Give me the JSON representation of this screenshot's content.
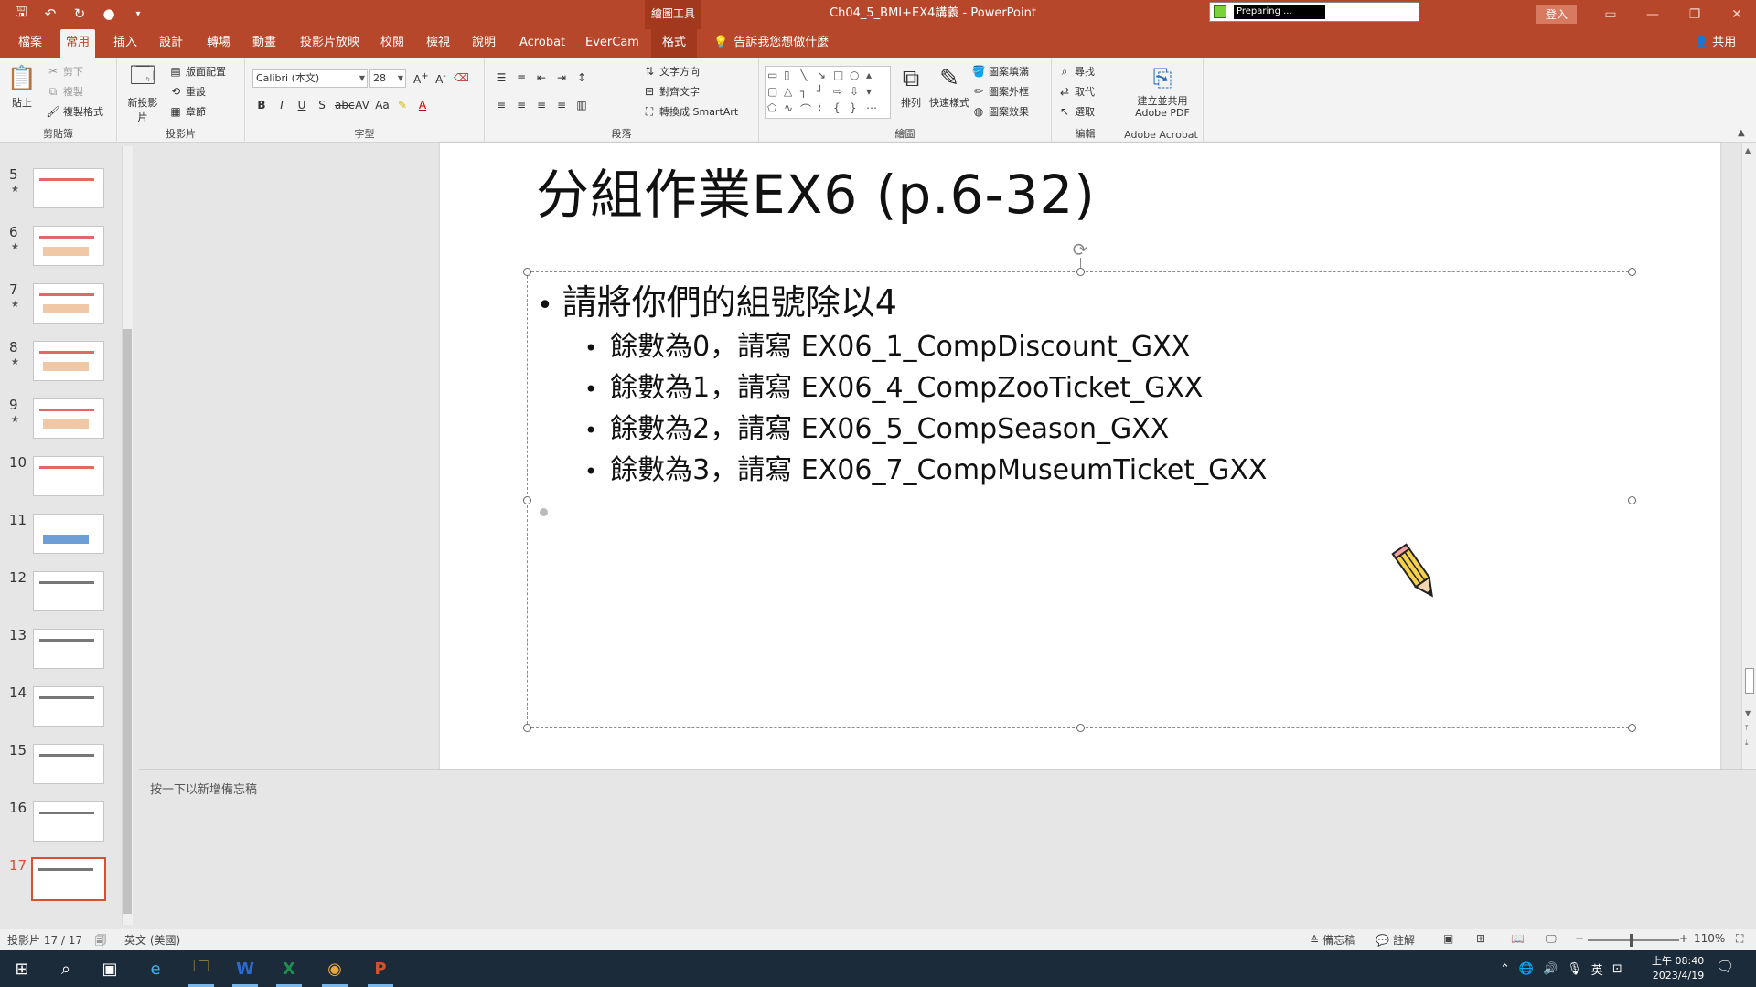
{
  "titlebar": {
    "context_group": "繪圖工具",
    "doc_title": "Ch04_5_BMI+EX4講義  -  PowerPoint",
    "preparing": "Preparing ...",
    "login": "登入"
  },
  "tabs": [
    "檔案",
    "常用",
    "插入",
    "設計",
    "轉場",
    "動畫",
    "投影片放映",
    "校閱",
    "檢視",
    "說明",
    "Acrobat",
    "EverCam",
    "格式"
  ],
  "tell_me": "告訴我您想做什麼",
  "share": "共用",
  "ribbon": {
    "clipboard": {
      "label": "剪貼簿",
      "paste": "貼上",
      "cut": "剪下",
      "copy": "複製",
      "format_painter": "複製格式"
    },
    "slides": {
      "label": "投影片",
      "new_slide": "新投影片",
      "layout": "版面配置",
      "reset": "重設",
      "section": "章節"
    },
    "font": {
      "label": "字型",
      "font_name": "Calibri (本文)",
      "font_size": "28"
    },
    "paragraph": {
      "label": "段落",
      "text_direction": "文字方向",
      "align_text": "對齊文字",
      "smartart": "轉換成 SmartArt"
    },
    "drawing": {
      "label": "繪圖",
      "arrange": "排列",
      "quick_styles": "快速樣式",
      "fill": "圖案填滿",
      "outline": "圖案外框",
      "effects": "圖案效果"
    },
    "editing": {
      "label": "編輯",
      "find": "尋找",
      "replace": "取代",
      "select": "選取"
    },
    "acrobat": {
      "label": "Adobe Acrobat",
      "create_share": "建立並共用 Adobe PDF"
    }
  },
  "thumbnails": {
    "numbers": [
      "5",
      "6",
      "7",
      "8",
      "9",
      "10",
      "11",
      "12",
      "13",
      "14",
      "15",
      "16",
      "17"
    ],
    "star": "★",
    "selected": "17"
  },
  "slide": {
    "title": "分組作業EX6 (p.6-32)",
    "main_bullet": "請將你們的組號除以4",
    "sub_bullets": [
      "餘數為0，請寫 EX06_1_CompDiscount_GXX",
      "餘數為1，請寫 EX06_4_CompZooTicket_GXX",
      "餘數為2，請寫 EX06_5_CompSeason_GXX",
      "餘數為3，請寫 EX06_7_CompMuseumTicket_GXX"
    ]
  },
  "notes": {
    "placeholder": "按一下以新增備忘稿"
  },
  "status": {
    "slide_counter": "投影片 17 / 17",
    "language": "英文 (美國)",
    "notes_btn": "備忘稿",
    "comments_btn": "註解",
    "zoom": "110%"
  },
  "taskbar": {
    "ime": "英",
    "time": "上午 08:40",
    "date": "2023/4/19"
  },
  "colors": {
    "accent": "#b7472a",
    "selected_thumb_border": "#d35230"
  }
}
